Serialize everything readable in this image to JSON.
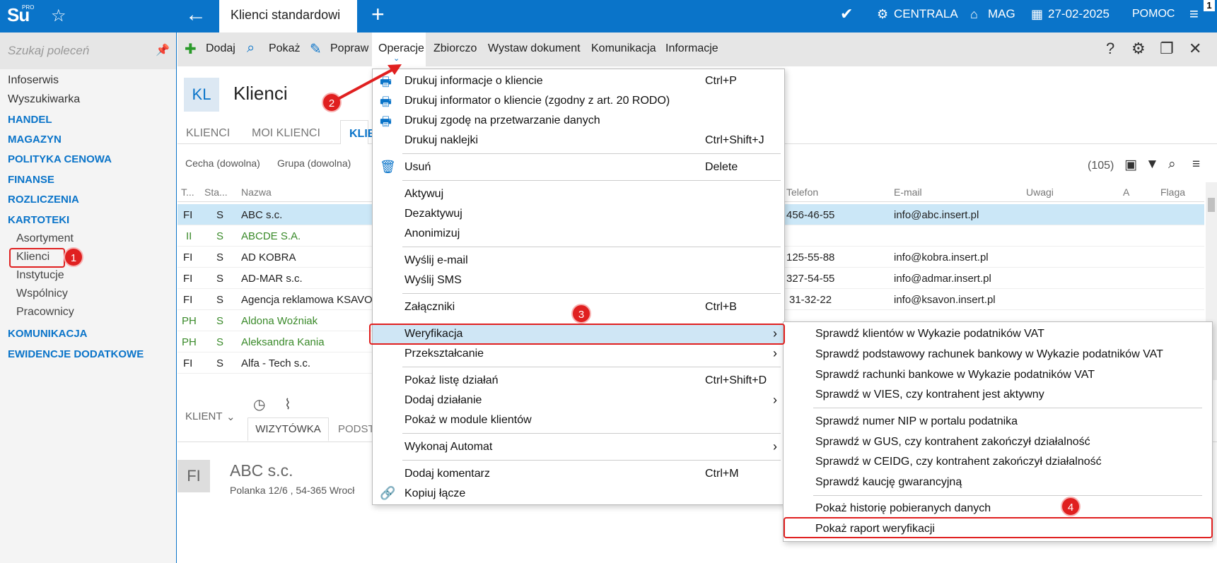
{
  "topbar": {
    "logo": "Su",
    "logo_sup": "PRO",
    "active_tab": "Klienci standardowi",
    "centrala": "CENTRALA",
    "mag": "MAG",
    "date": "27-02-2025",
    "pomoc": "POMOC",
    "corner": "1"
  },
  "sidebar": {
    "search_placeholder": "Szukaj poleceń",
    "infoserwis": "Infoserwis",
    "wyszukiwarka": "Wyszukiwarka",
    "categories": [
      "HANDEL",
      "MAGAZYN",
      "POLITYKA CENOWA",
      "FINANSE",
      "ROZLICZENIA",
      "KARTOTEKI"
    ],
    "kartoteki_items": [
      "Asortyment",
      "Klienci",
      "Instytucje",
      "Wspólnicy",
      "Pracownicy"
    ],
    "categories2": [
      "KOMUNIKACJA",
      "EWIDENCJE DODATKOWE"
    ]
  },
  "toolbar": {
    "dodaj": "Dodaj",
    "pokaz": "Pokaż",
    "popraw": "Popraw",
    "operacje": "Operacje",
    "zbiorczo": "Zbiorczo",
    "wystaw": "Wystaw dokument",
    "komunikacja": "Komunikacja",
    "informacje": "Informacje"
  },
  "main": {
    "badge": "KL",
    "title": "Klienci",
    "tabs": [
      "KLIENCI",
      "MOI KLIENCI",
      "KLIE"
    ],
    "filter_cecha": "Cecha (dowolna)",
    "filter_grupa": "Grupa (dowolna)",
    "count": "(105)",
    "columns": [
      "T...",
      "Sta...",
      "Nazwa",
      "Telefon",
      "E-mail",
      "Uwagi",
      "A",
      "Flaga"
    ],
    "rows": [
      {
        "t": "FI",
        "s": "S",
        "name": "ABC s.c.",
        "tel": "456-46-55",
        "email": "info@abc.insert.pl"
      },
      {
        "t": "II",
        "s": "S",
        "name": "ABCDE S.A.",
        "tel": "",
        "email": ""
      },
      {
        "t": "FI",
        "s": "S",
        "name": "AD KOBRA",
        "tel": "125-55-88",
        "email": "info@kobra.insert.pl"
      },
      {
        "t": "FI",
        "s": "S",
        "name": "AD-MAR s.c.",
        "tel": "327-54-55",
        "email": "info@admar.insert.pl"
      },
      {
        "t": "FI",
        "s": "S",
        "name": "Agencja reklamowa KSAVO",
        "tel": "31-32-22",
        "email": "info@ksavon.insert.pl"
      },
      {
        "t": "PH",
        "s": "S",
        "name": "Aldona Woźniak",
        "tel": "",
        "email": ""
      },
      {
        "t": "PH",
        "s": "S",
        "name": "Aleksandra Kania",
        "tel": "",
        "email": ""
      },
      {
        "t": "FI",
        "s": "S",
        "name": "Alfa - Tech s.c.",
        "tel": "",
        "email": ""
      }
    ],
    "detail_klient": "KLIENT",
    "detail_tab_wiz": "WIZYTÓWKA",
    "detail_tab_podst": "PODST",
    "detail_badge": "FI",
    "detail_name": "ABC s.c.",
    "detail_addr": "Polanka  12/6 , 54-365 Wrocł"
  },
  "menu": {
    "items": [
      {
        "label": "Drukuj informacje o kliencie",
        "shortcut": "Ctrl+P",
        "icon": "printer"
      },
      {
        "label": "Drukuj informator o kliencie (zgodny z art. 20 RODO)",
        "shortcut": "",
        "icon": "printer"
      },
      {
        "label": "Drukuj zgodę na przetwarzanie danych",
        "shortcut": "",
        "icon": "printer"
      },
      {
        "label": "Drukuj naklejki",
        "shortcut": "Ctrl+Shift+J",
        "icon": ""
      },
      {
        "label": "Usuń",
        "shortcut": "Delete",
        "icon": "trash"
      },
      {
        "label": "Aktywuj",
        "shortcut": "",
        "icon": ""
      },
      {
        "label": "Dezaktywuj",
        "shortcut": "",
        "icon": ""
      },
      {
        "label": "Anonimizuj",
        "shortcut": "",
        "icon": ""
      },
      {
        "label": "Wyślij e-mail",
        "shortcut": "",
        "icon": ""
      },
      {
        "label": "Wyślij SMS",
        "shortcut": "",
        "icon": ""
      },
      {
        "label": "Załączniki",
        "shortcut": "Ctrl+B",
        "icon": ""
      },
      {
        "label": "Weryfikacja",
        "shortcut": "",
        "icon": "",
        "submenu": true
      },
      {
        "label": "Przekształcanie",
        "shortcut": "",
        "icon": "",
        "submenu": true
      },
      {
        "label": "Pokaż listę działań",
        "shortcut": "Ctrl+Shift+D",
        "icon": ""
      },
      {
        "label": "Dodaj działanie",
        "shortcut": "",
        "icon": "",
        "submenu": true
      },
      {
        "label": "Pokaż w module klientów",
        "shortcut": "",
        "icon": ""
      },
      {
        "label": "Wykonaj Automat",
        "shortcut": "",
        "icon": "",
        "submenu": true
      },
      {
        "label": "Dodaj komentarz",
        "shortcut": "Ctrl+M",
        "icon": ""
      },
      {
        "label": "Kopiuj łącze",
        "shortcut": "",
        "icon": "link"
      }
    ]
  },
  "submenu": {
    "items": [
      "Sprawdź klientów w Wykazie podatników VAT",
      "Sprawdź podstawowy rachunek bankowy w Wykazie podatników VAT",
      "Sprawdź rachunki bankowe w Wykazie podatników VAT",
      "Sprawdź w VIES, czy kontrahent jest aktywny",
      "Sprawdź numer NIP w portalu podatnika",
      "Sprawdź w GUS, czy kontrahent zakończył działalność",
      "Sprawdź w CEIDG, czy kontrahent zakończył działalność",
      "Sprawdź kaucję gwarancyjną",
      "Pokaż historię pobieranych danych",
      "Pokaż raport weryfikacji"
    ]
  },
  "annotations": [
    "1",
    "2",
    "3",
    "4"
  ],
  "colors": {
    "brand": "#0a74c9",
    "highlight": "#cbe7f7",
    "annotation": "#e02020"
  }
}
